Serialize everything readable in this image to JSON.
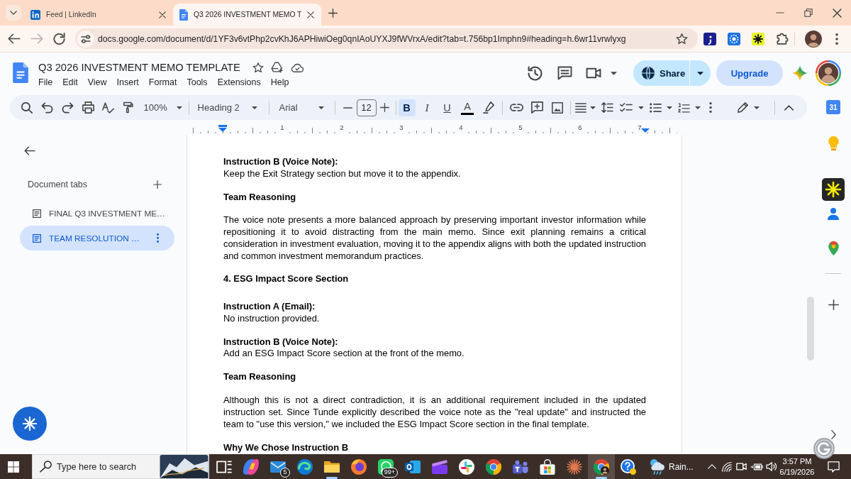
{
  "browser": {
    "tabs": [
      {
        "title": "Feed | LinkedIn",
        "selected": false
      },
      {
        "title": "Q3 2026 INVESTMENT MEMO T",
        "selected": true
      }
    ],
    "url": "docs.google.com/document/d/1YF3v6vtPhp2cvKhJ6APHiwiOeg0qnIAoUYXJ9fWVrxA/edit?tab=t.756bp1Imphn9#heading=h.6wr11vrwlyxg"
  },
  "header": {
    "title": "Q3 2026 INVESTMENT MEMO TEMPLATE",
    "menu": [
      "File",
      "Edit",
      "View",
      "Insert",
      "Format",
      "Tools",
      "Extensions",
      "Help"
    ],
    "share": "Share",
    "upgrade": "Upgrade"
  },
  "toolbar": {
    "zoom": "100%",
    "style": "Heading 2",
    "font": "Arial",
    "font_size": "12",
    "format": [
      {
        "kind": "bold",
        "label": "B",
        "selected": true
      },
      {
        "kind": "italic",
        "label": "I",
        "selected": false
      },
      {
        "kind": "underline",
        "label": "U",
        "selected": false
      },
      {
        "kind": "color",
        "label": "A",
        "selected": false
      }
    ]
  },
  "ruler": {
    "marks": [
      "1",
      "2",
      "3",
      "4",
      "5",
      "6",
      "7"
    ]
  },
  "sidebar": {
    "heading": "Document tabs",
    "tabs": [
      {
        "title": "FINAL Q3 INVESTMENT ME…",
        "selected": false
      },
      {
        "title": "TEAM RESOLUTION …",
        "selected": true
      }
    ]
  },
  "side_panel": {
    "calendar_day": "31"
  },
  "document": {
    "blocks": [
      {
        "kind": "instruction",
        "label": "Instruction B (Voice Note):",
        "text": "Keep the Exit Strategy section but move it to the appendix."
      },
      {
        "kind": "subheading",
        "text": "Team Reasoning"
      },
      {
        "kind": "paragraph",
        "text": "The voice note presents a more balanced approach by preserving important investor information while repositioning it to avoid distracting from the main memo. Since exit planning remains a critical consideration in investment evaluation, moving it to the appendix aligns with both the updated instruction and common investment memorandum practices."
      },
      {
        "kind": "heading",
        "text": "4. ESG Impact Score Section"
      },
      {
        "kind": "instruction",
        "label": "Instruction A (Email):",
        "text": "No instruction provided."
      },
      {
        "kind": "instruction",
        "label": "Instruction B (Voice Note):",
        "text": "Add an ESG Impact Score section at the front of the memo."
      },
      {
        "kind": "subheading",
        "text": "Team Reasoning"
      },
      {
        "kind": "paragraph",
        "text": "Although this is not a direct contradiction, it is an additional requirement included in the updated instruction set. Since Tunde explicitly described the voice note as the \"real update\" and instructed the team to \"use this version,\" we included the ESG Impact Score section in the final template."
      },
      {
        "kind": "subheading",
        "text": "Why We Chose Instruction B"
      }
    ]
  },
  "taskbar": {
    "search": {
      "placeholder": "Type here to search"
    },
    "apps": [
      {
        "kind": "taskview",
        "open": false,
        "active": false
      },
      {
        "kind": "swirl",
        "open": false,
        "active": false
      },
      {
        "kind": "mail",
        "count": "5",
        "open": false,
        "active": false
      },
      {
        "kind": "wave",
        "open": false,
        "active": false
      },
      {
        "kind": "folder",
        "open": true,
        "active": false
      },
      {
        "kind": "fox",
        "open": false,
        "active": false
      },
      {
        "kind": "chat",
        "count": "99+",
        "open": false,
        "active": false
      },
      {
        "kind": "mailapp",
        "open": false,
        "active": false
      },
      {
        "kind": "clapper",
        "open": false,
        "active": false
      },
      {
        "kind": "pinwheel",
        "open": false,
        "active": false
      },
      {
        "kind": "wheel",
        "open": false,
        "active": false
      },
      {
        "kind": "people",
        "open": false,
        "active": false
      },
      {
        "kind": "bag",
        "open": false,
        "active": false
      },
      {
        "kind": "starburst",
        "open": false,
        "active": false
      },
      {
        "kind": "profile",
        "open": true,
        "active": true
      },
      {
        "kind": "help",
        "open": false,
        "active": false
      }
    ],
    "weather": "Rain...",
    "time": "3:57 PM",
    "date": "6/19/2026"
  }
}
